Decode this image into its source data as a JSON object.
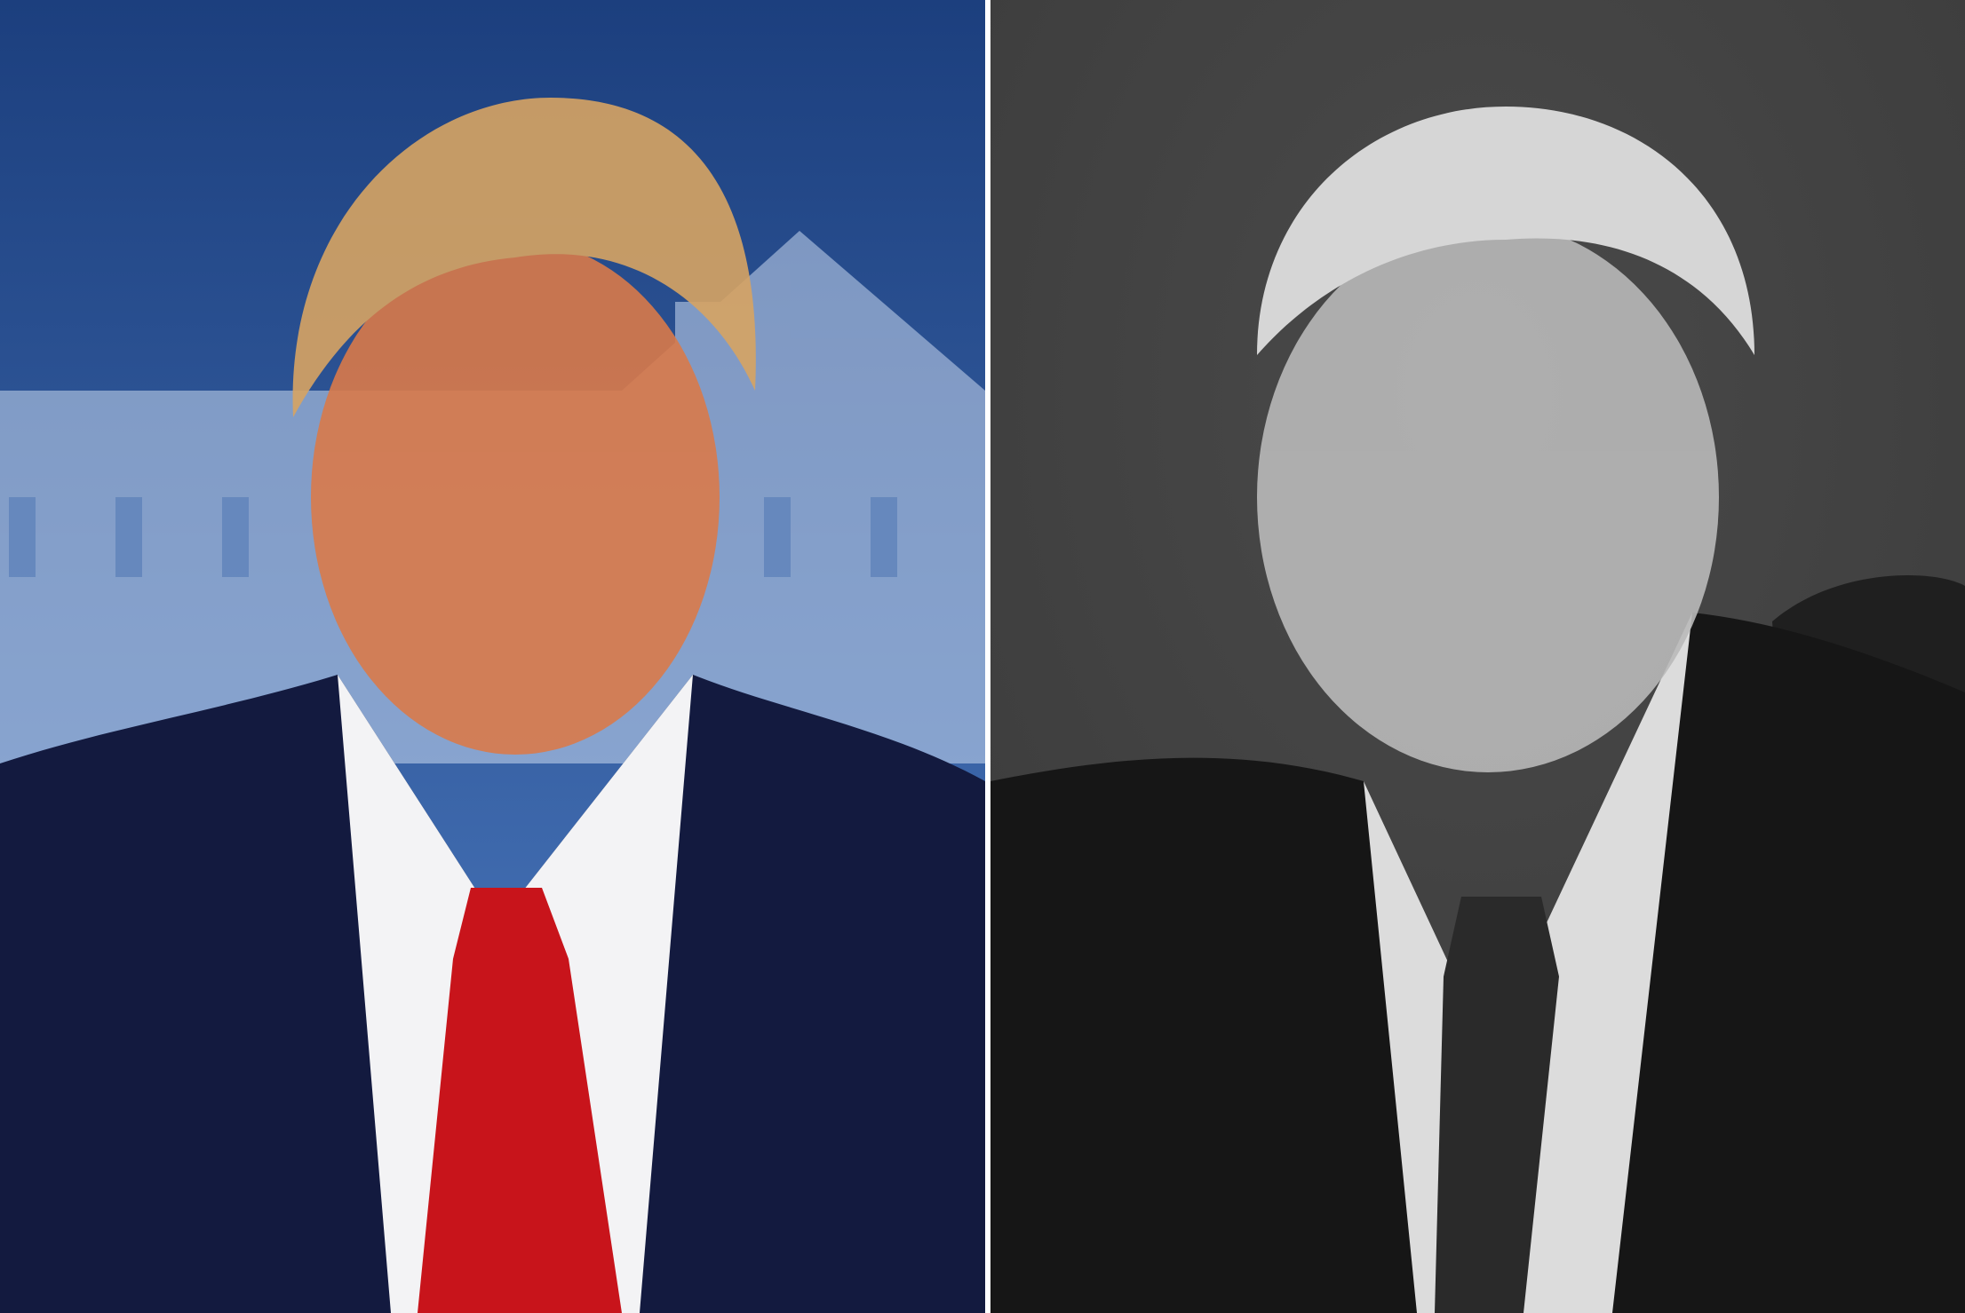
{
  "colors": {
    "divider": "#ffffff",
    "left_backdrop_top": "#1c3f7e",
    "left_backdrop_bottom": "#4f7ec4",
    "left_building": "#c9d8f0",
    "left_suit": "#131a3f",
    "left_shirt": "#f3f3f5",
    "left_tie": "#c8141b",
    "left_skin": "#d97a4a",
    "left_hair": "#d7a463",
    "right_backdrop": "#3a3a3a",
    "right_suit": "#161616",
    "right_shirt": "#dcdcdc",
    "right_tie": "#2a2a2a",
    "right_skin": "#b9b9b9",
    "right_hair": "#e6e6e6"
  }
}
